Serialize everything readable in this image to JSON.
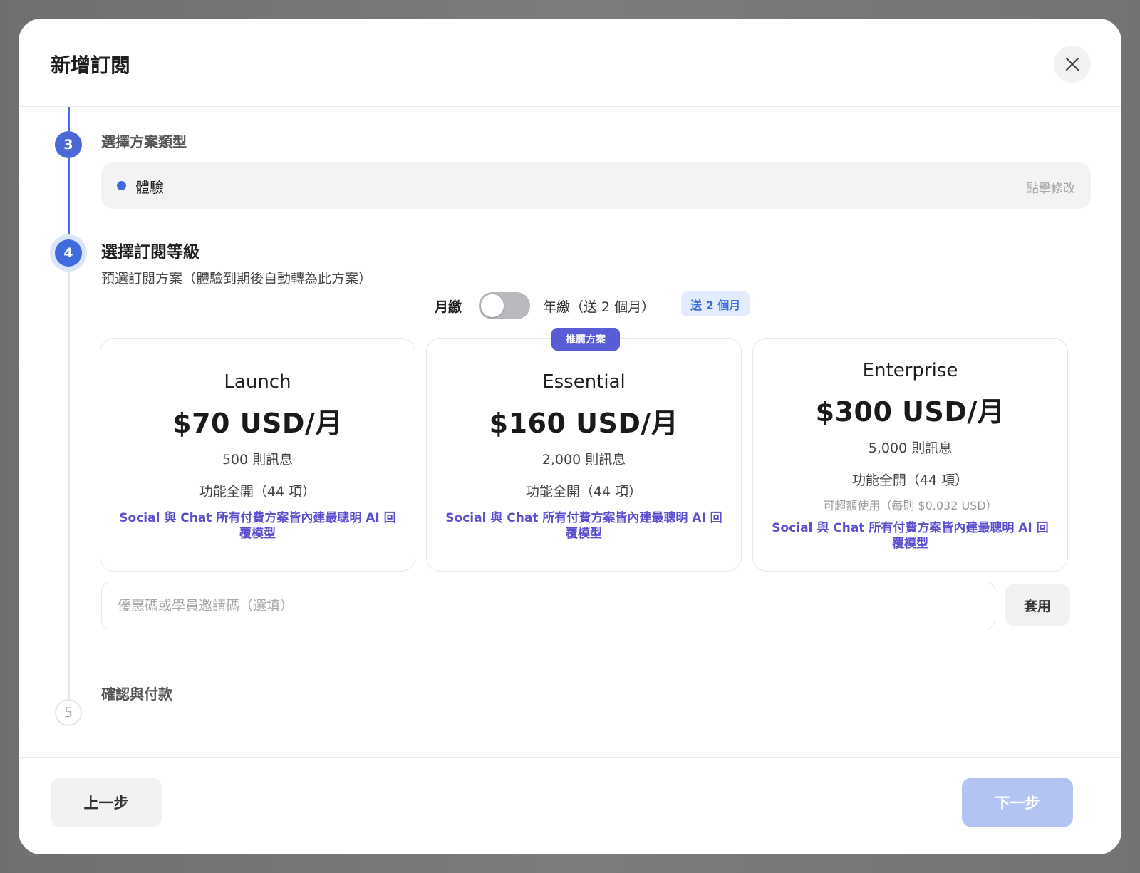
{
  "modal": {
    "title": "新增訂閱",
    "close_icon": "close-icon"
  },
  "steps": {
    "step3": {
      "number": "3",
      "title": "選擇方案類型",
      "selected_plan_type": "體驗",
      "edit_hint": "點擊修改"
    },
    "step4": {
      "number": "4",
      "title": "選擇訂閱等級",
      "subtitle": "預選訂閱方案（體驗到期後自動轉為此方案）"
    },
    "step5": {
      "number": "5",
      "title": "確認與付款"
    }
  },
  "billing": {
    "monthly_label": "月繳",
    "yearly_label": "年繳（送 2 個月）",
    "bonus_badge": "送 2 個月",
    "toggle_state": "monthly"
  },
  "plans": [
    {
      "name": "Launch",
      "price": "$70 USD/月",
      "messages": "500 則訊息",
      "features": "功能全開（44 項）",
      "ai_note": "Social 與 Chat 所有付費方案皆內建最聰明 AI 回覆模型"
    },
    {
      "name": "Essential",
      "price": "$160 USD/月",
      "messages": "2,000 則訊息",
      "features": "功能全開（44 項）",
      "ai_note": "Social 與 Chat 所有付費方案皆內建最聰明 AI 回覆模型",
      "badge": "推薦方案"
    },
    {
      "name": "Enterprise",
      "price": "$300 USD/月",
      "messages": "5,000 則訊息",
      "features": "功能全開（44 項）",
      "overage": "可超額使用（每則 $0.032 USD）",
      "ai_note": "Social 與 Chat 所有付費方案皆內建最聰明 AI 回覆模型"
    }
  ],
  "coupon": {
    "placeholder": "優惠碼或學員邀請碼（選填）",
    "value": "",
    "apply_label": "套用"
  },
  "footer": {
    "prev_label": "上一步",
    "next_label": "下一步"
  },
  "colors": {
    "accent": "#3f6bde",
    "ai_note": "#5b4fcf",
    "recommend_badge": "#5a5cd6",
    "next_disabled": "#b3c3f2"
  }
}
